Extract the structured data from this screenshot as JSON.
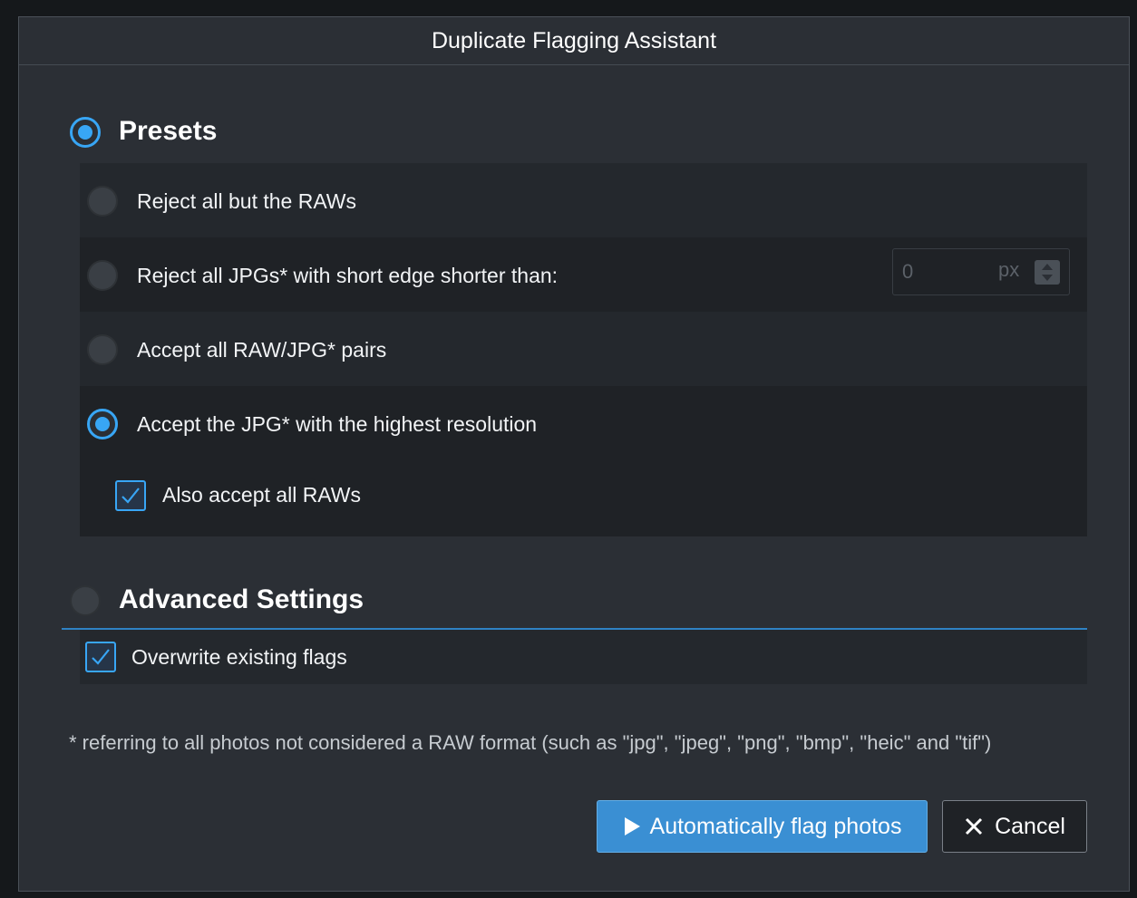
{
  "dialog": {
    "title": "Duplicate Flagging Assistant"
  },
  "presets": {
    "title": "Presets",
    "selected": true,
    "options": [
      {
        "label": "Reject all but the RAWs",
        "selected": false
      },
      {
        "label": "Reject all JPGs* with short edge shorter than:",
        "selected": false
      },
      {
        "label": "Accept all RAW/JPG* pairs",
        "selected": false
      },
      {
        "label": "Accept the JPG* with the highest resolution",
        "selected": true
      }
    ],
    "short_edge_input": {
      "value": "0",
      "unit": "px"
    },
    "also_accept_raws": {
      "label": "Also accept all RAWs",
      "checked": true
    }
  },
  "advanced": {
    "title": "Advanced Settings",
    "selected": false,
    "overwrite_flags": {
      "label": "Overwrite existing flags",
      "checked": true
    }
  },
  "footnote": "* referring to all photos not considered a RAW format (such as \"jpg\", \"jpeg\", \"png\", \"bmp\", \"heic\" and \"tif\")",
  "buttons": {
    "auto_flag": "Automatically flag photos",
    "cancel": "Cancel"
  },
  "colors": {
    "accent": "#38a6f5",
    "primary_button": "#3a8fd3",
    "dialog_bg": "#2b2f35"
  }
}
